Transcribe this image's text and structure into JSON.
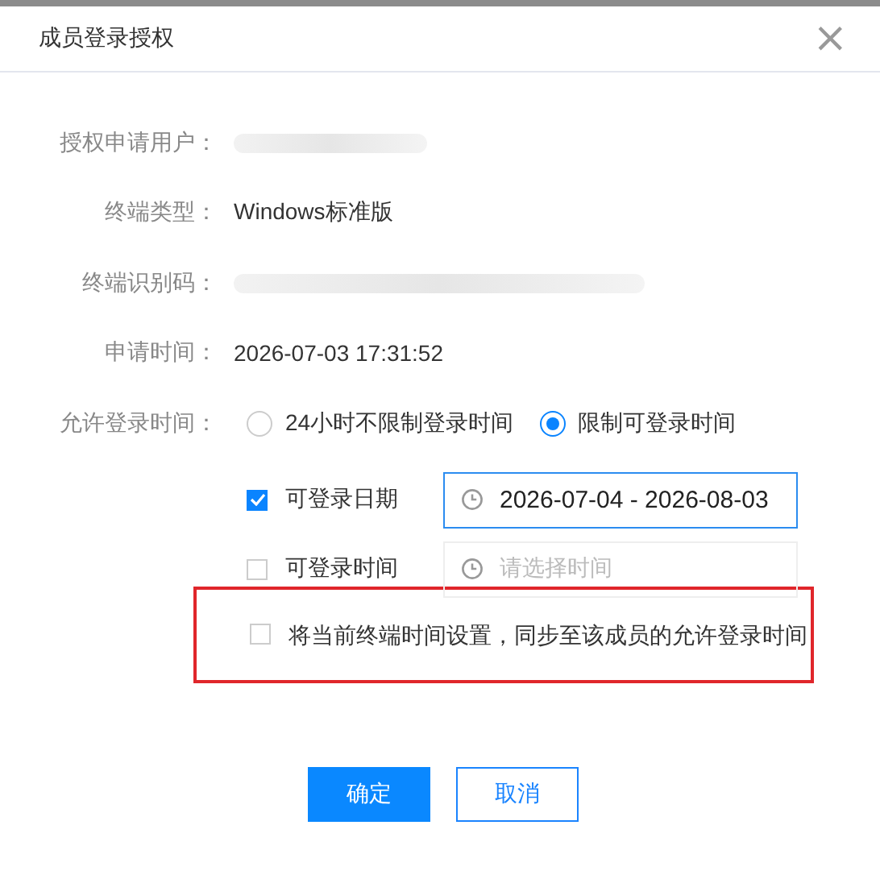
{
  "dialog": {
    "title": "成员登录授权",
    "close": "×"
  },
  "fields": [
    {
      "label": "授权申请用户：",
      "redacted": true
    },
    {
      "label": "终端类型：",
      "value": "Windows标准版"
    },
    {
      "label": "终端识别码：",
      "redacted": true
    },
    {
      "label": "申请时间：",
      "value": "2026-07-03 17:31:52"
    }
  ],
  "login_time": {
    "label": "允许登录时间：",
    "options": [
      {
        "label": "24小时不限制登录时间",
        "selected": false
      },
      {
        "label": "限制可登录时间",
        "selected": true
      }
    ]
  },
  "restrictions": [
    {
      "label": "可登录日期",
      "checked": true,
      "value": "2026-07-04 - 2026-08-03",
      "focused": true
    },
    {
      "label": "可登录时间",
      "checked": false,
      "placeholder": "请选择时间",
      "focused": false
    }
  ],
  "sync": {
    "label": "将当前终端时间设置，同步至该成员的允许登录时间",
    "checked": false,
    "highlighted": true
  },
  "buttons": [
    {
      "label": "确定",
      "kind": "primary"
    },
    {
      "label": "取消",
      "kind": "secondary"
    }
  ]
}
